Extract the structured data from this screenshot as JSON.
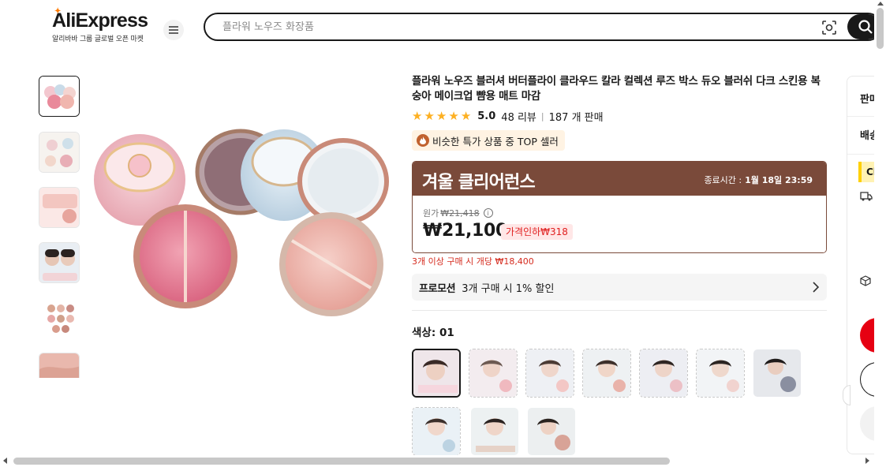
{
  "brand": {
    "logo_text": "AliExpress",
    "tagline": "알리바바 그룹 글로벌 오픈 마켓"
  },
  "search": {
    "placeholder": "플라워 노우즈 화장품"
  },
  "icons": {
    "menu": "hamburger-icon",
    "camera": "image-search-icon",
    "search": "magnifier-icon"
  },
  "product": {
    "title": "플라워 노우즈 블러셔 버터플라이 클라우드 칼라 컬렉션 루즈 박스 듀오 블러쉬 다크 스킨용 복숭아 메이크업 뺨용 매트 마감",
    "rating": "5.0",
    "reviews": "48 리뷰",
    "sold": "187 개 판매",
    "badge": "비슷한 특가 상품 중 TOP 셀러"
  },
  "deal": {
    "name": "겨울 클리어런스",
    "ends_label": "종료시간 :",
    "ends_value": "1월 18일 23:59",
    "original_label": "원가",
    "original_price": "₩21,418",
    "price": "₩21,100",
    "discount": "가격인하₩318",
    "bulk_note": "3개 이상 구매 시 개당 ₩18,400"
  },
  "promotion": {
    "label": "프로모션",
    "text": "3개 구매 시 1% 할인"
  },
  "color": {
    "label": "색상: 01",
    "swatch_count": 10,
    "selected_index": 0
  },
  "side_panel": {
    "seller_label": "판매",
    "shipping_label": "배송",
    "choice_label": "Ch"
  },
  "colors": {
    "deal_brown": "#7a4a3a",
    "price_red": "#e02020",
    "star": "#fdb022",
    "buy_red": "#e60012"
  }
}
